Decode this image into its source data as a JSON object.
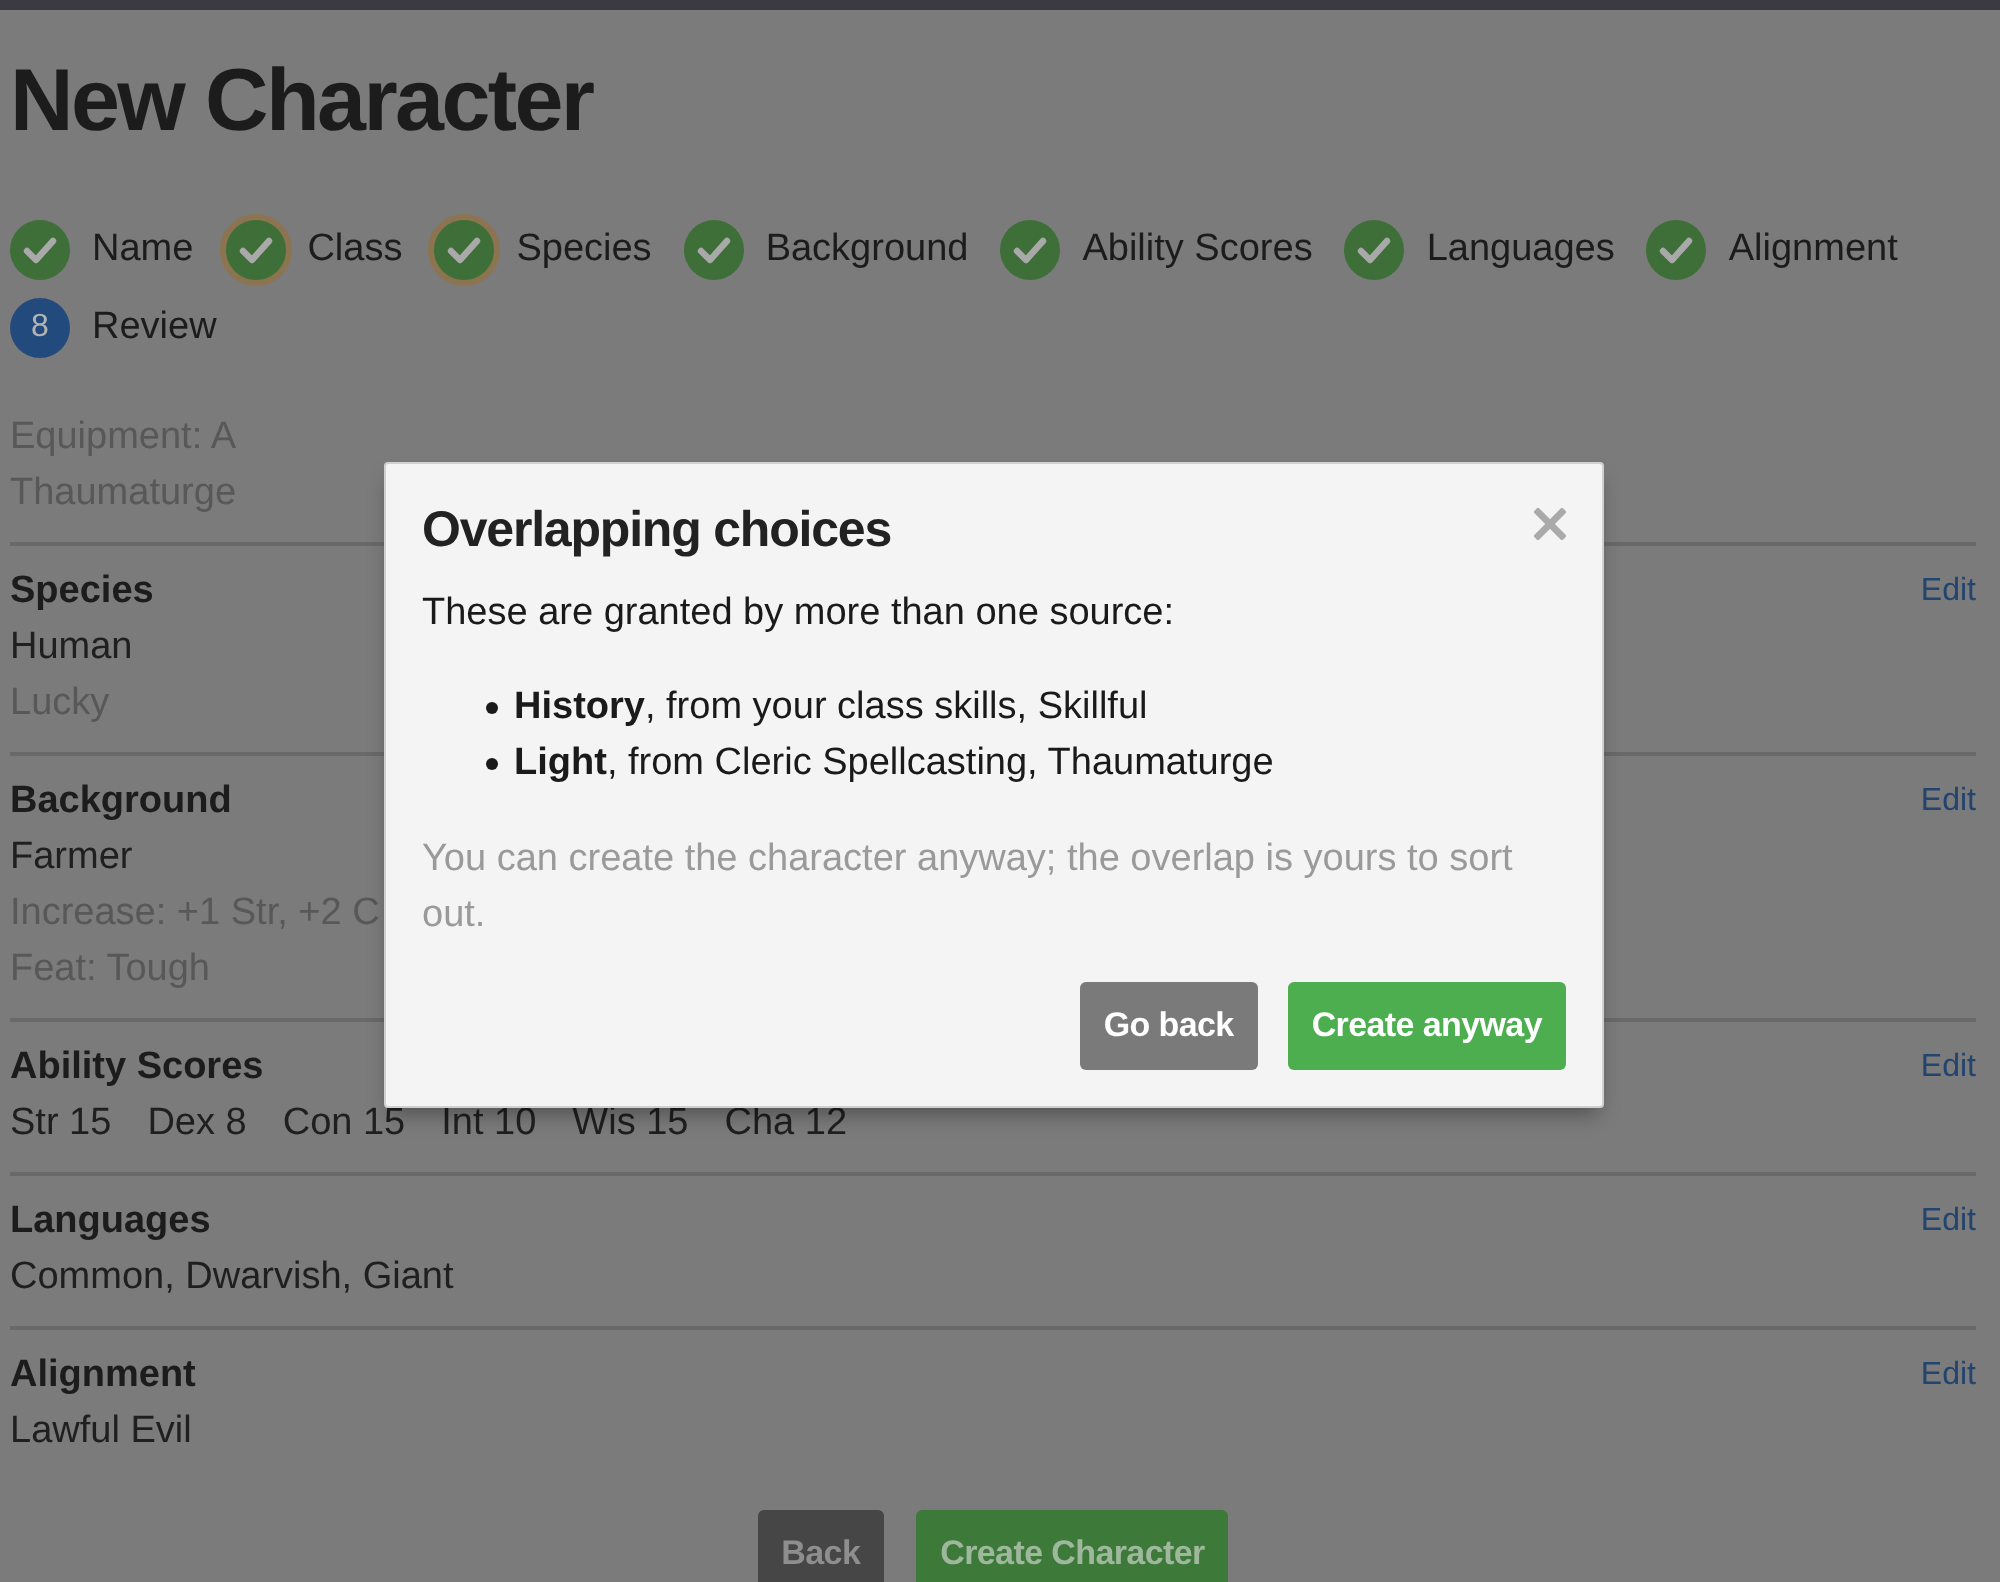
{
  "page": {
    "title": "New Character"
  },
  "steps": [
    {
      "label": "Name",
      "completed": true,
      "warning": false
    },
    {
      "label": "Class",
      "completed": true,
      "warning": true
    },
    {
      "label": "Species",
      "completed": true,
      "warning": true
    },
    {
      "label": "Background",
      "completed": true,
      "warning": false
    },
    {
      "label": "Ability Scores",
      "completed": true,
      "warning": false
    },
    {
      "label": "Languages",
      "completed": true,
      "warning": false
    },
    {
      "label": "Alignment",
      "completed": true,
      "warning": false
    },
    {
      "label": "Review",
      "completed": false,
      "number": "8",
      "warning": false
    }
  ],
  "sections": [
    {
      "kind": "lines",
      "lines": [
        {
          "text": "Equipment: A",
          "muted": true
        },
        {
          "text": "Thaumaturge",
          "muted": true
        }
      ]
    },
    {
      "kind": "lines",
      "heading": "Species",
      "edit_link": "Edit",
      "lines": [
        {
          "text": "Human",
          "muted": false
        },
        {
          "text": "Lucky",
          "muted": true
        }
      ]
    },
    {
      "kind": "lines",
      "heading": "Background",
      "edit_link": "Edit",
      "lines": [
        {
          "text": "Farmer",
          "muted": false
        },
        {
          "text": "Increase: +1 Str, +2 C",
          "muted": true
        },
        {
          "text": "Feat: Tough",
          "muted": true
        }
      ]
    },
    {
      "kind": "scores",
      "heading": "Ability Scores",
      "edit_link": "Edit",
      "scores": [
        "Str 15",
        "Dex 8",
        "Con 15",
        "Int 10",
        "Wis 15",
        "Cha 12"
      ]
    },
    {
      "kind": "lines",
      "heading": "Languages",
      "edit_link": "Edit",
      "lines": [
        {
          "text": "Common, Dwarvish, Giant",
          "muted": false
        }
      ]
    },
    {
      "kind": "lines",
      "heading": "Alignment",
      "edit_link": "Edit",
      "lines": [
        {
          "text": "Lawful Evil",
          "muted": false
        }
      ]
    }
  ],
  "footer_buttons": [
    {
      "label": "Back",
      "kind": "secondary"
    },
    {
      "label": "Create Character",
      "kind": "primary"
    }
  ],
  "modal": {
    "title": "Overlapping choices",
    "intro": "These are granted by more than one source:",
    "items": [
      "**History**, from your class skills, Skillful",
      "**Light**, from Cleric Spellcasting, Thaumaturge"
    ],
    "note": "You can create the character anyway; the overlap is yours to sort out.",
    "buttons": [
      {
        "label": "Go back",
        "kind": "secondary"
      },
      {
        "label": "Create anyway",
        "kind": "primary"
      }
    ]
  }
}
